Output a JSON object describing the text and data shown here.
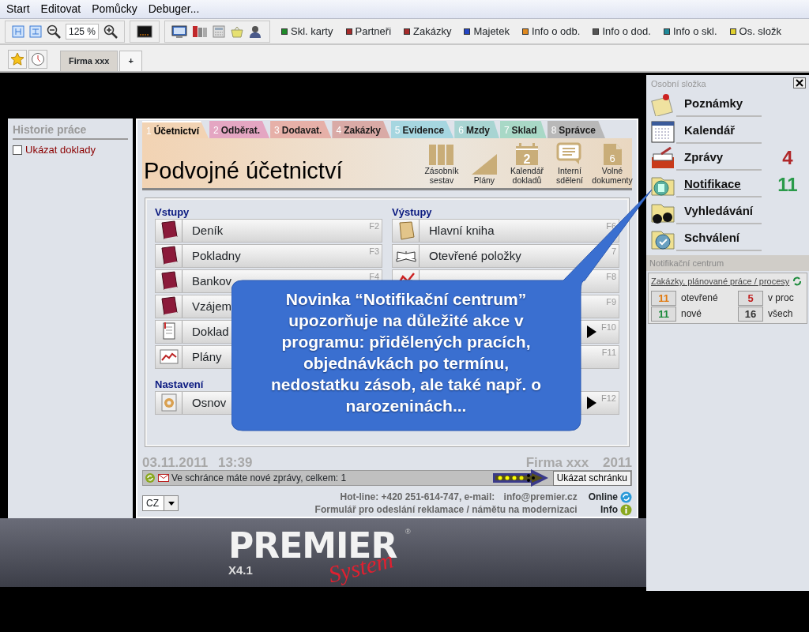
{
  "menu": [
    "Start",
    "Editovat",
    "Pomůcky",
    "Debuger..."
  ],
  "toolbar": {
    "zoom": "125 %",
    "shortcuts": [
      {
        "label": "Skl. karty",
        "color": "#1f8a2a"
      },
      {
        "label": "Partneři",
        "color": "#a62a2a"
      },
      {
        "label": "Zakázky",
        "color": "#a62a2a"
      },
      {
        "label": "Majetek",
        "color": "#2445c4"
      },
      {
        "label": "Info o odb.",
        "color": "#e08a20"
      },
      {
        "label": "Info o dod.",
        "color": "#555555"
      },
      {
        "label": "Info o skl.",
        "color": "#1f8a9a"
      },
      {
        "label": "Os. složk",
        "color": "#e0d030"
      }
    ]
  },
  "doc_tabs": [
    {
      "label": "Firma xxx",
      "selected": true
    },
    {
      "label": "+",
      "selected": false
    }
  ],
  "left_panel": {
    "title": "Historie práce",
    "checkbox": {
      "label": "Ukázat doklady",
      "checked": false
    }
  },
  "module_tabs": [
    {
      "number": "1",
      "label": "Účetnictví",
      "color": "#f2d3b3",
      "selected": true
    },
    {
      "number": "2",
      "label": "Odběrat.",
      "color": "#e4a6c2",
      "selected": false
    },
    {
      "number": "3",
      "label": "Dodavat.",
      "color": "#e6b0a8",
      "selected": false
    },
    {
      "number": "4",
      "label": "Zakázky",
      "color": "#d9aaa6",
      "selected": false
    },
    {
      "number": "5",
      "label": "Evidence",
      "color": "#a6d6e0",
      "selected": false
    },
    {
      "number": "6",
      "label": "Mzdy",
      "color": "#a8d4d2",
      "selected": false
    },
    {
      "number": "7",
      "label": "Sklad",
      "color": "#a8d8c6",
      "selected": false
    },
    {
      "number": "8",
      "label": "Správce",
      "color": "#b8b8b8",
      "selected": false
    }
  ],
  "header": {
    "title": "Podvojné účetnictví",
    "tools": [
      {
        "label": "Zásobník sestav"
      },
      {
        "label": "Plány"
      },
      {
        "label": "Kalendář dokladů",
        "icon_text": "2"
      },
      {
        "label": "Interní sdělení"
      },
      {
        "label": "Volné dokumenty",
        "icon_text": "6"
      }
    ]
  },
  "sections": [
    {
      "headings": [
        "Vstupy",
        "Výstupy"
      ],
      "rows": [
        {
          "left": {
            "label": "Deník",
            "key": "F2",
            "arrow": false
          },
          "right": {
            "label": "Hlavní kniha",
            "key": "F6",
            "arrow": false
          }
        },
        {
          "left": {
            "label": "Pokladny",
            "key": "F3",
            "arrow": false
          },
          "right": {
            "label": "Otevřené položky",
            "key": "7",
            "arrow": false
          }
        },
        {
          "left": {
            "label": "Bankov",
            "key": "F4",
            "arrow": false
          },
          "right": {
            "key": "F8",
            "arrow": false
          }
        },
        {
          "left": {
            "label": "Vzájem",
            "arrow": false
          },
          "right": {
            "key": "F9",
            "arrow": false
          }
        },
        {
          "left": {
            "label": "Doklad",
            "arrow": false
          },
          "right": {
            "key": "F10",
            "arrow": true
          }
        },
        {
          "left": {
            "label": "Plány",
            "arrow": false
          },
          "right": {
            "key": "F11",
            "arrow": false
          }
        }
      ]
    },
    {
      "headings": [
        "Nastavení"
      ],
      "rows": [
        {
          "left": {
            "label": "Osnov",
            "arrow": false
          },
          "right": {
            "key": "F12",
            "arrow": true
          }
        }
      ]
    }
  ],
  "callout": "Novinka “Notifikační centrum” upozorňuje na důležité akce v programu: přidělených pracích, objednávkách po termínu, nedostatku zásob, ale také např. o narozeninách...",
  "status": {
    "date": "03.11.2011",
    "time": "13:39",
    "company": "Firma xxx",
    "year": "2011",
    "message": "Ve schránce máte nové zprávy, celkem: 1",
    "inbox_button": "Ukázat schránku"
  },
  "footer": {
    "language": "CZ",
    "hotline": "Hot-line: +420 251-614-747, e-mail:",
    "email": "info@premier.cz",
    "form_link": "Formulář pro odeslání reklamace / námětu na modernizaci",
    "online": "Online",
    "info": "Info"
  },
  "logo": {
    "name": "PREMIER",
    "registered": "®",
    "script": "System",
    "version": "X4.1"
  },
  "right_panel": {
    "title": "Osobní složka",
    "items": [
      {
        "label": "Poznámky",
        "selected": false
      },
      {
        "label": "Kalendář",
        "selected": false
      },
      {
        "label": "Zprávy",
        "selected": false,
        "count": "4",
        "color": "#b0282a"
      },
      {
        "label": "Notifikace",
        "selected": true,
        "count": "11",
        "color": "#2a9a4a"
      },
      {
        "label": "Vyhledávání",
        "selected": false
      },
      {
        "label": "Schválení",
        "selected": false
      }
    ]
  },
  "notification_center": {
    "title": "Notifikační centrum",
    "link": "Zakázky, plánované práce / procesy",
    "stats": [
      {
        "value": "11",
        "label": "otevřené",
        "color": "#e07a10"
      },
      {
        "value": "5",
        "label": "v proc",
        "color": "#c02020"
      },
      {
        "value": "11",
        "label": "nové",
        "color": "#1a8a3a"
      },
      {
        "value": "16",
        "label": "všech",
        "color": "#333333"
      }
    ]
  }
}
